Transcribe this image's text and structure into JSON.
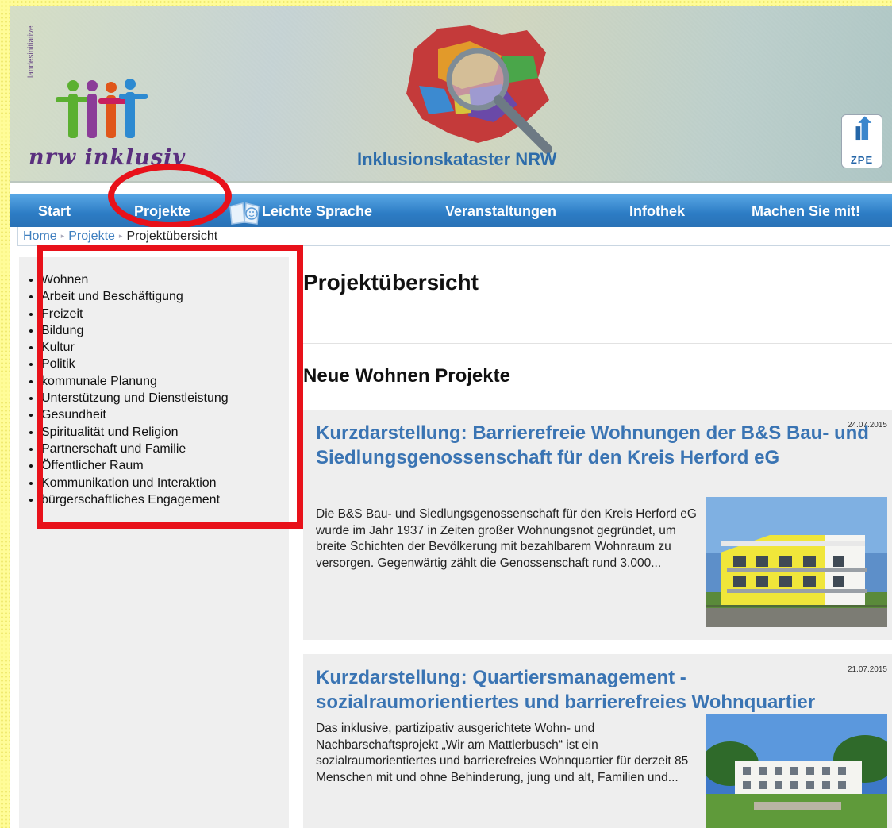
{
  "header": {
    "logo_left_vertical": "landesinitiative",
    "logo_left_word": "nrw inklusiv",
    "center_title": "Inklusionskataster NRW",
    "zpe_logo_text": "ZPE"
  },
  "nav": {
    "items": [
      {
        "label": "Start"
      },
      {
        "label": "Projekte"
      },
      {
        "label": "Leichte Sprache"
      },
      {
        "label": "Veranstaltungen"
      },
      {
        "label": "Infothek"
      },
      {
        "label": "Machen Sie mit!"
      }
    ]
  },
  "breadcrumb": {
    "items": [
      {
        "label": "Home"
      },
      {
        "label": "Projekte"
      },
      {
        "label": "Projektübersicht"
      }
    ]
  },
  "sidebar": {
    "items": [
      {
        "label": "Wohnen"
      },
      {
        "label": "Arbeit und Beschäftigung"
      },
      {
        "label": "Freizeit"
      },
      {
        "label": "Bildung"
      },
      {
        "label": "Kultur"
      },
      {
        "label": "Politik"
      },
      {
        "label": "kommunale Planung"
      },
      {
        "label": "Unterstützung und Dienstleistung"
      },
      {
        "label": "Gesundheit"
      },
      {
        "label": "Spiritualität und Religion"
      },
      {
        "label": "Partnerschaft und Familie"
      },
      {
        "label": "Öffentlicher Raum"
      },
      {
        "label": "Kommunikation und Interaktion"
      },
      {
        "label": "bürgerschaftliches Engagement"
      }
    ]
  },
  "main": {
    "title": "Projektübersicht",
    "section_title": "Neue Wohnen Projekte",
    "cards": [
      {
        "date": "24.07.2015",
        "title": "Kurzdarstellung: Barrierefreie Wohnungen der B&S Bau- und Siedlungsgenossenschaft für den Kreis Herford eG",
        "text": "Die B&S Bau- und Siedlungsgenossenschaft für den Kreis Herford eG wurde im Jahr 1937 in Zeiten großer Wohnungsnot gegründet, um breite Schichten der Bevölkerung mit bezahlbarem Wohnraum zu versorgen. Gegenwärtig zählt die Genossenschaft rund 3.000..."
      },
      {
        "date": "21.07.2015",
        "title": "Kurzdarstellung: Quartiersmanagement - sozialraumorientiertes und barrierefreies Wohnquartier",
        "text": "Das inklusive, partizipativ ausgerichtete Wohn- und Nachbarschaftsprojekt „Wir am Mattlerbusch“ ist ein sozialraumorientiertes und barrierefreies Wohnquartier für derzeit 85 Menschen mit und ohne Behinderung, jung und alt, Familien und..."
      }
    ]
  },
  "colors": {
    "nav_blue": "#2c7cc4",
    "link_blue": "#3a74b3",
    "highlight_red": "#e8111a",
    "page_edge_yellow": "#fffb9e"
  }
}
